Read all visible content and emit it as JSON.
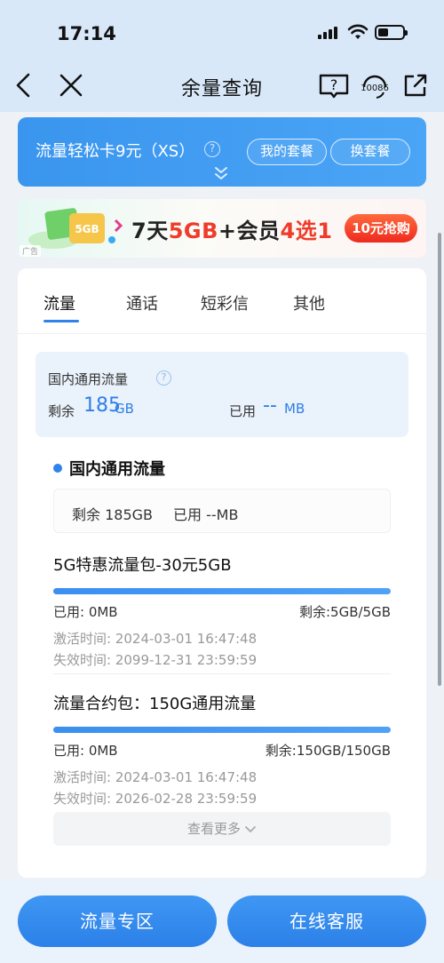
{
  "status_bar": {
    "time": "17:14"
  },
  "nav": {
    "title": "余量查询",
    "headset_label": "10086"
  },
  "package": {
    "name": "流量轻松卡9元（XS）",
    "my_plan": "我的套餐",
    "change_plan": "换套餐"
  },
  "ad": {
    "tag": "广告",
    "art_label": "5GB",
    "text_1": "7天",
    "text_2": "5GB",
    "text_3": "+会员",
    "text_4": "4选1",
    "button": "10元抢购"
  },
  "tabs": [
    "流量",
    "通话",
    "短彩信",
    "其他"
  ],
  "summary": {
    "title": "国内通用流量",
    "remain_label": "剩余",
    "remain_value": "185",
    "remain_unit": "GB",
    "used_label": "已用",
    "used_value": "--",
    "used_unit": "MB"
  },
  "section": {
    "title": "国内通用流量",
    "remain": "剩余 185GB",
    "used": "已用 --MB"
  },
  "packs": [
    {
      "name": "5G特惠流量包-30元5GB",
      "used": "已用: 0MB",
      "remain": "剩余:5GB/5GB",
      "remaining_fraction": 1.0,
      "activated": "激活时间: 2024-03-01 16:47:48",
      "expires": "失效时间: 2099-12-31 23:59:59"
    },
    {
      "name": "流量合约包：150G通用流量",
      "used": "已用: 0MB",
      "remain": "剩余:150GB/150GB",
      "remaining_fraction": 1.0,
      "activated": "激活时间: 2024-03-01 16:47:48",
      "expires": "失效时间: 2026-02-28 23:59:59"
    }
  ],
  "more": "查看更多",
  "bottom": {
    "left": "流量专区",
    "right": "在线客服"
  },
  "colors": {
    "accent": "#2f83ea",
    "ad_red": "#ef3b2a"
  },
  "icons": [
    "back-icon",
    "close-icon",
    "help-book-icon",
    "headset-icon",
    "share-icon",
    "chevron-down-icon",
    "question-icon",
    "wifi-icon",
    "signal-icon",
    "battery-icon"
  ]
}
